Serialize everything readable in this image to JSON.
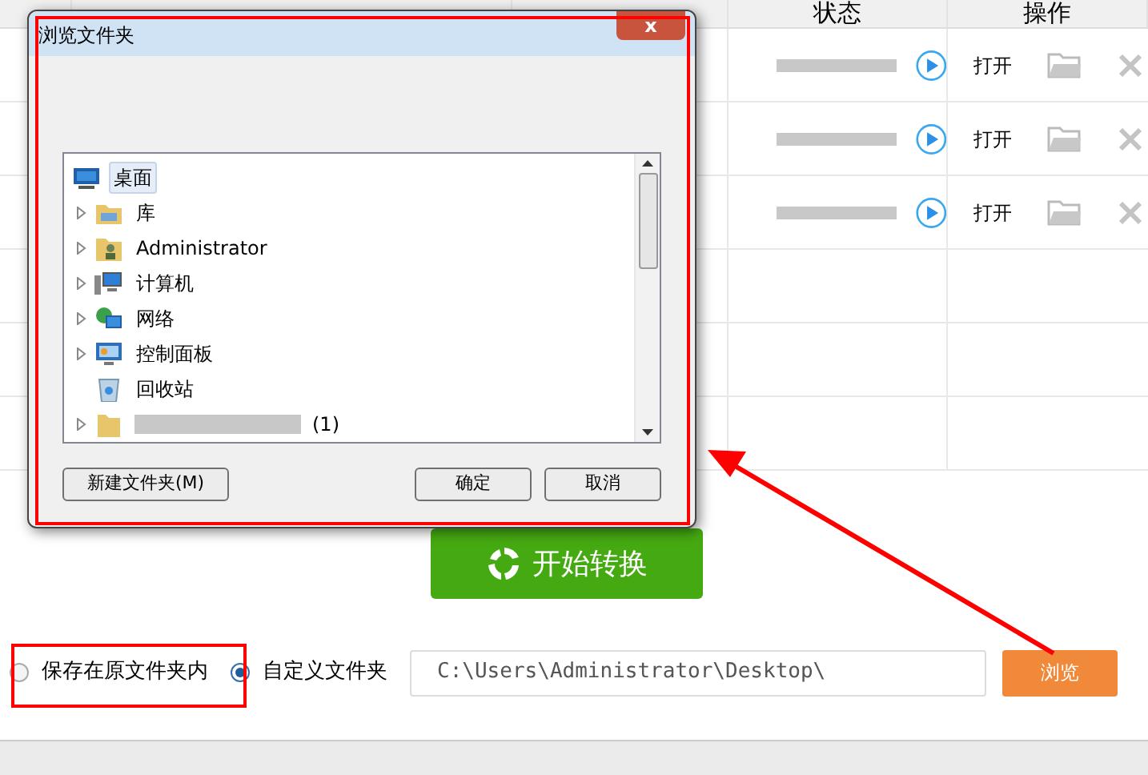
{
  "table": {
    "columns": [
      "状态",
      "操作"
    ],
    "rows": [
      {
        "action": "打开"
      },
      {
        "action": "打开"
      },
      {
        "action": "打开"
      }
    ]
  },
  "start_button": "开始转换",
  "save_options": [
    {
      "label": "保存在原文件夹内",
      "selected": false
    },
    {
      "label": "自定义文件夹",
      "selected": true
    }
  ],
  "path_field": {
    "value": "C:\\Users\\Administrator\\Desktop\\"
  },
  "browse_button": "浏览",
  "dialog": {
    "title": "浏览文件夹",
    "close": "x",
    "tree": [
      {
        "label": "桌面",
        "kind": "desktop",
        "selected": true,
        "children": [
          {
            "label": "库",
            "kind": "library",
            "expandable": true,
            "selected": false
          },
          {
            "label": "Administrator",
            "kind": "user",
            "expandable": true,
            "selected": false
          },
          {
            "label": "计算机",
            "kind": "computer",
            "expandable": true,
            "selected": false
          },
          {
            "label": "网络",
            "kind": "network",
            "expandable": true,
            "selected": false
          },
          {
            "label": "控制面板",
            "kind": "control",
            "expandable": true,
            "selected": false
          },
          {
            "label": "回收站",
            "kind": "recycle",
            "expandable": false,
            "selected": false
          },
          {
            "label": "(1)",
            "kind": "redacted",
            "expandable": true,
            "selected": false
          }
        ]
      }
    ],
    "buttons": [
      {
        "label": "新建文件夹(M)",
        "kind": "new"
      },
      {
        "label": "确定",
        "kind": "ok"
      },
      {
        "label": "取消",
        "kind": "cancel"
      }
    ]
  }
}
